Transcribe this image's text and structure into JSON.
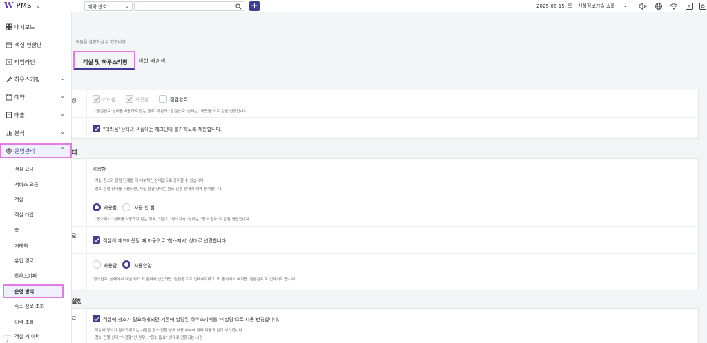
{
  "app": {
    "logo_mark": "W",
    "name": "PMS"
  },
  "topbar": {
    "search_type": "예약 번호",
    "date": "2025-05-15, 목",
    "hotel": "신하정보기술 쇼룸",
    "plus_label": "+",
    "icons": [
      "mute-icon",
      "globe-icon",
      "wifi-icon",
      "help-icon",
      "settings-icon"
    ]
  },
  "sidebar": {
    "items": [
      {
        "label": "대시보드",
        "icon": "dashboard-icon"
      },
      {
        "label": "객실 현황판",
        "icon": "calendar-icon"
      },
      {
        "label": "타임라인",
        "icon": "timeline-icon"
      },
      {
        "label": "하우스키핑",
        "icon": "housekeeping-icon",
        "chevron": "⌄"
      },
      {
        "label": "예약",
        "icon": "reservation-icon",
        "chevron": "⌄"
      },
      {
        "label": "매출",
        "icon": "sales-icon",
        "chevron": "⌄"
      },
      {
        "label": "분석",
        "icon": "analysis-icon",
        "chevron": "⌄"
      },
      {
        "label": "운영관리",
        "icon": "gear-icon",
        "chevron": "⌃"
      }
    ],
    "sub_items": [
      "객실 요금",
      "서비스 요금",
      "객실",
      "객실 타입",
      "층",
      "거래처",
      "유입 경로",
      "하우스키퍼",
      "운영 방식",
      "숙소 정보 조회",
      "이력 조회",
      "객실 키 이력"
    ],
    "active_sub": "운영 방식",
    "collapse_label": "›"
  },
  "main": {
    "description": "...작들을 설정하실 수 있습니다.",
    "tabs": [
      {
        "label": "객실 및 하우스키핑",
        "active": true
      },
      {
        "label": "객실 배경색",
        "active": false
      }
    ],
    "card1": {
      "row1_label_fragment": "성",
      "options": [
        {
          "label": "더러움",
          "checked": true,
          "disabled": true
        },
        {
          "label": "깨끗함",
          "checked": true,
          "disabled": true
        },
        {
          "label": "점검완료",
          "checked": false,
          "disabled": false
        }
      ],
      "note": "· \"점검완료\"상태를 사용하지 않는 경우, 기존의 \"점검완료\" 상태는 \"깨끗함\"으로 일괄 변경됩니다.",
      "restrict_label": "\"더러움\"상태의 객실에는 체크인이 불가하도록 제한합니다.",
      "restrict_checked": true
    },
    "card2": {
      "title_fragment": "태",
      "use_heading": "사용함",
      "notes": [
        "· 객실 청소와 점검 단계를 더 세부적인 상태값으로 관리할 수 있습니다.",
        "· 청소 진행 상태를 사용하면, 객실 청결 상태는 청소 진행 상태에 의해 동작합니다."
      ],
      "radio1": {
        "on": "사용함",
        "off": "사용 안 함"
      },
      "radio1_note": "· \"청소지시\" 상태를 사용하지 않는 경우, 기존의 \"청소지시\" 상태는 \"청소 필요\"로 일괄 변경됩니다.",
      "row3_label_fragment": "로",
      "checkout_label": "객실이 체크아웃될 때 자동으로 '청소지시' 상태로 변경합니다.",
      "checkout_checked": true,
      "radio2": {
        "off": "사용함",
        "on": "사용안함"
      },
      "radio2_note": "'청소완료' 상태에서 객실 키가 키 홀더에 삽입되면 '점검중'으로 업데이트하고, 키 홀더에서 빠지면 '점검완료'로 업데이트 합니다."
    },
    "card3": {
      "title_fragment": "설정",
      "row_label_fragment": "로",
      "assign_label": "객실에 청소가 필요하게되면 기존에 할당된 하우스키퍼를 '미할당'으로 자동 변경합니다.",
      "assign_checked": true,
      "notes": [
        "· 객실에 청소가 필요하게되는 시점은 청소 진행 상태 사용 여부에 따라 다음과 같이 상이합니다.",
        "· 청소 진행 상태 \"사용함\"인 경우 : \"청소 필요\" 상태로 전환되는 시점"
      ]
    }
  }
}
